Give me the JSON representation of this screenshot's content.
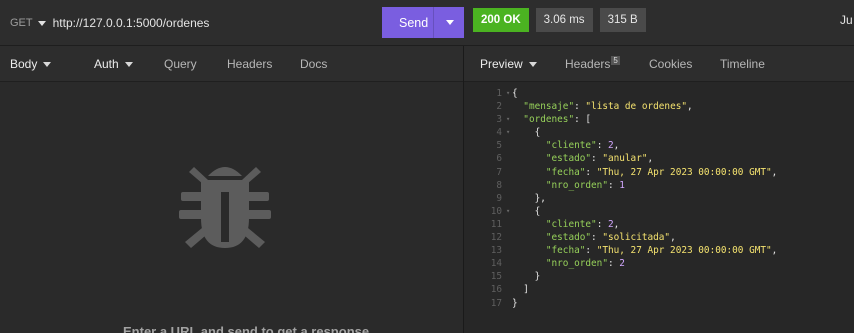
{
  "request": {
    "method": "GET",
    "url": "http://127.0.0.1:5000/ordenes",
    "send_label": "Send"
  },
  "status": {
    "code": "200 OK",
    "time": "3.06 ms",
    "size": "315 B",
    "cut_text": "Ju",
    "ok_color": "#4bb321"
  },
  "left_tabs": [
    {
      "label": "Body",
      "dropdown": true
    },
    {
      "label": "Auth",
      "dropdown": true
    },
    {
      "label": "Query"
    },
    {
      "label": "Headers"
    },
    {
      "label": "Docs"
    }
  ],
  "left_empty": {
    "icon": "bug-icon",
    "message": "Enter a URL and send to get a response"
  },
  "right_tabs": [
    {
      "label": "Preview",
      "dropdown": true
    },
    {
      "label": "Headers",
      "count": "5"
    },
    {
      "label": "Cookies"
    },
    {
      "label": "Timeline"
    }
  ],
  "response_lines": [
    {
      "n": "1",
      "fold": "▾",
      "parts": [
        [
          "p",
          "{"
        ]
      ]
    },
    {
      "n": "2",
      "fold": "",
      "parts": [
        [
          "p",
          "  "
        ],
        [
          "k",
          "\"mensaje\""
        ],
        [
          "p",
          ": "
        ],
        [
          "s",
          "\"lista de ordenes\""
        ],
        [
          "p",
          ","
        ]
      ]
    },
    {
      "n": "3",
      "fold": "▾",
      "parts": [
        [
          "p",
          "  "
        ],
        [
          "k",
          "\"ordenes\""
        ],
        [
          "p",
          ": ["
        ]
      ]
    },
    {
      "n": "4",
      "fold": "▾",
      "parts": [
        [
          "p",
          "    {"
        ]
      ]
    },
    {
      "n": "5",
      "fold": "",
      "parts": [
        [
          "p",
          "      "
        ],
        [
          "k",
          "\"cliente\""
        ],
        [
          "p",
          ": "
        ],
        [
          "n",
          "2"
        ],
        [
          "p",
          ","
        ]
      ]
    },
    {
      "n": "6",
      "fold": "",
      "parts": [
        [
          "p",
          "      "
        ],
        [
          "k",
          "\"estado\""
        ],
        [
          "p",
          ": "
        ],
        [
          "s",
          "\"anular\""
        ],
        [
          "p",
          ","
        ]
      ]
    },
    {
      "n": "7",
      "fold": "",
      "parts": [
        [
          "p",
          "      "
        ],
        [
          "k",
          "\"fecha\""
        ],
        [
          "p",
          ": "
        ],
        [
          "s",
          "\"Thu, 27 Apr 2023 00:00:00 GMT\""
        ],
        [
          "p",
          ","
        ]
      ]
    },
    {
      "n": "8",
      "fold": "",
      "parts": [
        [
          "p",
          "      "
        ],
        [
          "k",
          "\"nro_orden\""
        ],
        [
          "p",
          ": "
        ],
        [
          "n",
          "1"
        ]
      ]
    },
    {
      "n": "9",
      "fold": "",
      "parts": [
        [
          "p",
          "    },"
        ]
      ]
    },
    {
      "n": "10",
      "fold": "▾",
      "parts": [
        [
          "p",
          "    {"
        ]
      ]
    },
    {
      "n": "11",
      "fold": "",
      "parts": [
        [
          "p",
          "      "
        ],
        [
          "k",
          "\"cliente\""
        ],
        [
          "p",
          ": "
        ],
        [
          "n",
          "2"
        ],
        [
          "p",
          ","
        ]
      ]
    },
    {
      "n": "12",
      "fold": "",
      "parts": [
        [
          "p",
          "      "
        ],
        [
          "k",
          "\"estado\""
        ],
        [
          "p",
          ": "
        ],
        [
          "s",
          "\"solicitada\""
        ],
        [
          "p",
          ","
        ]
      ]
    },
    {
      "n": "13",
      "fold": "",
      "parts": [
        [
          "p",
          "      "
        ],
        [
          "k",
          "\"fecha\""
        ],
        [
          "p",
          ": "
        ],
        [
          "s",
          "\"Thu, 27 Apr 2023 00:00:00 GMT\""
        ],
        [
          "p",
          ","
        ]
      ]
    },
    {
      "n": "14",
      "fold": "",
      "parts": [
        [
          "p",
          "      "
        ],
        [
          "k",
          "\"nro_orden\""
        ],
        [
          "p",
          ": "
        ],
        [
          "n",
          "2"
        ]
      ]
    },
    {
      "n": "15",
      "fold": "",
      "parts": [
        [
          "p",
          "    }"
        ]
      ]
    },
    {
      "n": "16",
      "fold": "",
      "parts": [
        [
          "p",
          "  ]"
        ]
      ]
    },
    {
      "n": "17",
      "fold": "",
      "parts": [
        [
          "p",
          "}"
        ]
      ]
    }
  ]
}
